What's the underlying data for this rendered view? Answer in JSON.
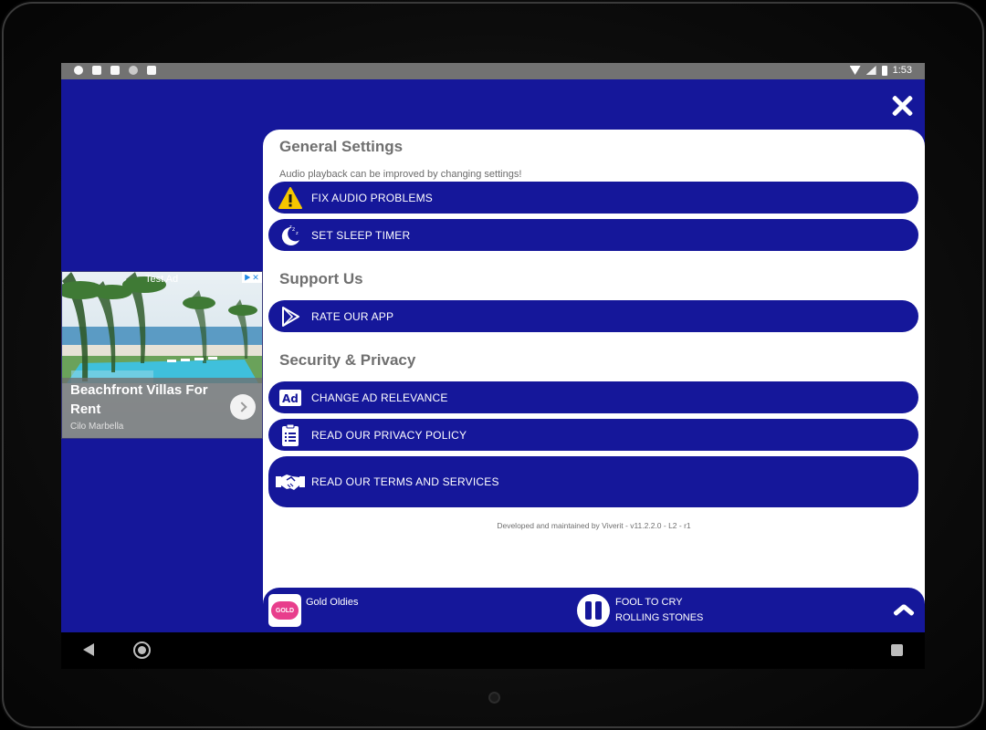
{
  "statusbar": {
    "time": "1:53",
    "icons": [
      "notification-icon",
      "app-icon",
      "debug-icon",
      "record-icon",
      "sd-card-icon",
      "wifi-icon",
      "signal-icon",
      "battery-icon"
    ]
  },
  "ad": {
    "tag": "Test Ad",
    "title": "Beachfront Villas For Rent",
    "advertiser": "Cilo Marbella"
  },
  "settings": {
    "general": {
      "title": "General Settings",
      "description": "Audio playback can be improved by changing settings!",
      "items": [
        {
          "label": "FIX AUDIO PROBLEMS",
          "icon": "warning-icon"
        },
        {
          "label": "SET SLEEP TIMER",
          "icon": "sleep-moon-icon"
        }
      ]
    },
    "support": {
      "title": "Support Us",
      "items": [
        {
          "label": "RATE OUR APP",
          "icon": "play-store-icon"
        }
      ]
    },
    "security": {
      "title": "Security & Privacy",
      "items": [
        {
          "label": "CHANGE AD RELEVANCE",
          "icon": "ad-icon"
        },
        {
          "label": "READ OUR PRIVACY POLICY",
          "icon": "clipboard-icon"
        },
        {
          "label": "READ OUR TERMS AND SERVICES",
          "icon": "handshake-icon"
        }
      ]
    },
    "footer": "Developed and maintained by Viverit - v11.2.2.0 - L2 - r1"
  },
  "player": {
    "station": "Gold Oldies",
    "station_logo_text": "GOLD",
    "track_title": "FOOL TO CRY",
    "track_artist": "ROLLING STONES"
  },
  "colors": {
    "brand_blue": "#15179a",
    "warning_yellow": "#f6c700"
  }
}
